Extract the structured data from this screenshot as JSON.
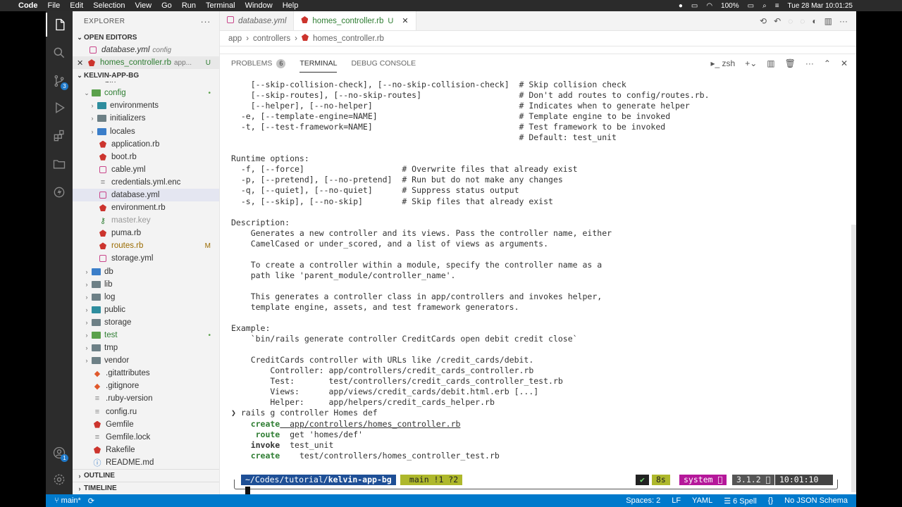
{
  "menubar": {
    "app": "Code",
    "items": [
      "File",
      "Edit",
      "Selection",
      "View",
      "Go",
      "Run",
      "Terminal",
      "Window",
      "Help"
    ],
    "battery": "100%",
    "clock": "Tue 28 Mar  10:01:25"
  },
  "sidebar": {
    "title": "EXPLORER",
    "open_editors_label": "OPEN EDITORS",
    "open_editors": [
      {
        "name": "database.yml",
        "desc": "config"
      },
      {
        "name": "homes_controller.rb",
        "desc": "app...",
        "deco": "U"
      }
    ],
    "project_label": "KELVIN-APP-BG",
    "partial_item": "bin",
    "tree": [
      {
        "name": "config",
        "type": "folder",
        "deco": "•"
      },
      {
        "name": "environments",
        "type": "folder"
      },
      {
        "name": "initializers",
        "type": "folder"
      },
      {
        "name": "locales",
        "type": "folder"
      },
      {
        "name": "application.rb",
        "type": "rb"
      },
      {
        "name": "boot.rb",
        "type": "rb"
      },
      {
        "name": "cable.yml",
        "type": "yml"
      },
      {
        "name": "credentials.yml.enc",
        "type": "file"
      },
      {
        "name": "database.yml",
        "type": "yml"
      },
      {
        "name": "environment.rb",
        "type": "rb"
      },
      {
        "name": "master.key",
        "type": "key"
      },
      {
        "name": "puma.rb",
        "type": "rb"
      },
      {
        "name": "routes.rb",
        "type": "rb",
        "deco": "M"
      },
      {
        "name": "storage.yml",
        "type": "yml"
      },
      {
        "name": "db",
        "type": "folder"
      },
      {
        "name": "lib",
        "type": "folder"
      },
      {
        "name": "log",
        "type": "folder"
      },
      {
        "name": "public",
        "type": "folder"
      },
      {
        "name": "storage",
        "type": "folder"
      },
      {
        "name": "test",
        "type": "folder",
        "deco": "•"
      },
      {
        "name": "tmp",
        "type": "folder"
      },
      {
        "name": "vendor",
        "type": "folder"
      },
      {
        "name": ".gitattributes",
        "type": "git"
      },
      {
        "name": ".gitignore",
        "type": "git"
      },
      {
        "name": ".ruby-version",
        "type": "file"
      },
      {
        "name": "config.ru",
        "type": "file"
      },
      {
        "name": "Gemfile",
        "type": "rb"
      },
      {
        "name": "Gemfile.lock",
        "type": "file"
      },
      {
        "name": "Rakefile",
        "type": "rb"
      },
      {
        "name": "README.md",
        "type": "md"
      }
    ],
    "outline_label": "OUTLINE",
    "timeline_label": "TIMELINE"
  },
  "tabs": [
    {
      "name": "database.yml"
    },
    {
      "name": "homes_controller.rb",
      "mod": "U"
    }
  ],
  "breadcrumb": [
    "app",
    "controllers",
    "homes_controller.rb"
  ],
  "panel": {
    "tabs": [
      "PROBLEMS",
      "TERMINAL",
      "DEBUG CONSOLE"
    ],
    "problems_count": "6",
    "shell": "zsh"
  },
  "terminal": {
    "lines": [
      "    [--skip-collision-check], [--no-skip-collision-check]  # Skip collision check",
      "    [--skip-routes], [--no-skip-routes]                    # Don't add routes to config/routes.rb.",
      "    [--helper], [--no-helper]                              # Indicates when to generate helper",
      "  -e, [--template-engine=NAME]                             # Template engine to be invoked",
      "  -t, [--test-framework=NAME]                              # Test framework to be invoked",
      "                                                           # Default: test_unit",
      "",
      "Runtime options:",
      "  -f, [--force]                    # Overwrite files that already exist",
      "  -p, [--pretend], [--no-pretend]  # Run but do not make any changes",
      "  -q, [--quiet], [--no-quiet]      # Suppress status output",
      "  -s, [--skip], [--no-skip]        # Skip files that already exist",
      "",
      "Description:",
      "    Generates a new controller and its views. Pass the controller name, either",
      "    CamelCased or under_scored, and a list of views as arguments.",
      "",
      "    To create a controller within a module, specify the controller name as a",
      "    path like 'parent_module/controller_name'.",
      "",
      "    This generates a controller class in app/controllers and invokes helper,",
      "    template engine, assets, and test framework generators.",
      "",
      "Example:",
      "    `bin/rails generate controller CreditCards open debit credit close`",
      "",
      "    CreditCards controller with URLs like /credit_cards/debit.",
      "        Controller: app/controllers/credit_cards_controller.rb",
      "        Test:       test/controllers/credit_cards_controller_test.rb",
      "        Views:      app/views/credit_cards/debit.html.erb [...]",
      "        Helper:     app/helpers/credit_cards_helper.rb"
    ],
    "command": "❯ rails g controller Homes def",
    "gen": [
      {
        "verb": "    create",
        "path": "  app/controllers/homes_controller.rb"
      },
      {
        "verb": "     route",
        "path": "  get 'homes/def'"
      },
      {
        "verb": "    invoke",
        "path": "  test_unit"
      },
      {
        "verb": "    create",
        "path": "    test/controllers/homes_controller_test.rb"
      }
    ],
    "prompt": {
      "path_prefix": "~/Codes/tutorial/",
      "path_bold": "kelvin-app-bg",
      "branch": " main !1 ?2",
      "check": "✔",
      "duration": "8s",
      "ruby_env": "system 󰙨",
      "ruby_ver": "3.1.2 󰙨",
      "time": "10:01:10"
    }
  },
  "status": {
    "branch": "main*",
    "spaces": "Spaces: 2",
    "eol": "LF",
    "lang": "YAML",
    "spell": "6 Spell",
    "schema": "No JSON Schema"
  },
  "colors": {
    "accent": "#007acc",
    "activity_bar": "#2c2c2c",
    "prompt_blue": "#1e4f96",
    "prompt_olive": "#aeb82c",
    "prompt_magenta": "#b5189a"
  }
}
